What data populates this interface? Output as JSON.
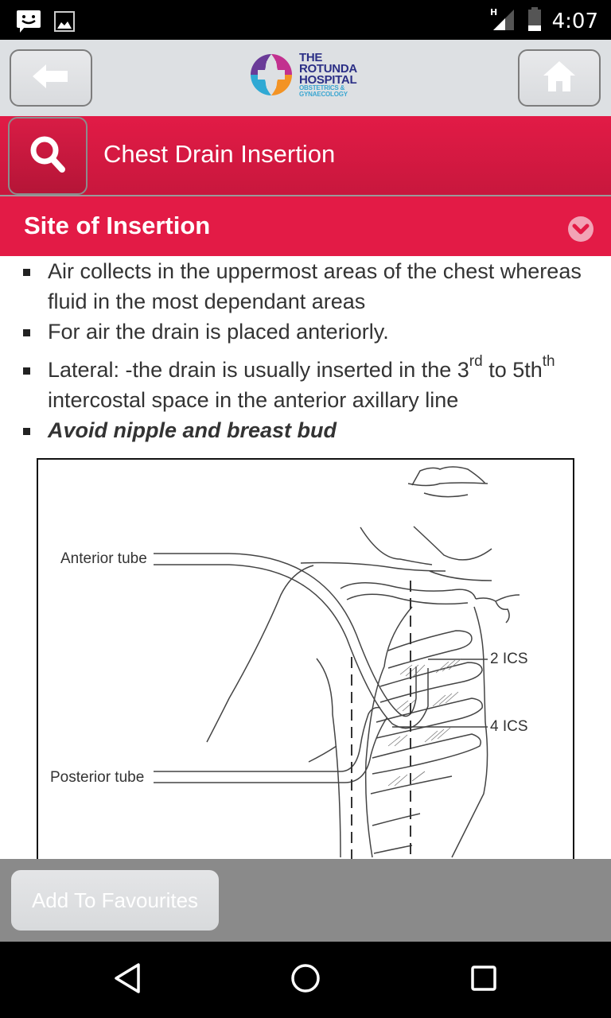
{
  "status_bar": {
    "left_icons": [
      "messenger-icon",
      "image-icon"
    ],
    "network_type": "H",
    "battery_level_fraction": 0.25,
    "time": "4:07"
  },
  "header": {
    "back_icon": "arrow-left-icon",
    "home_icon": "home-icon",
    "logo": {
      "line1": "THE",
      "line2": "ROTUNDA",
      "line3": "HOSPITAL",
      "line4": "OBSTETRICS &",
      "line5": "GYNAECOLOGY"
    }
  },
  "title_bar": {
    "search_icon": "search-icon",
    "title": "Chest Drain Insertion"
  },
  "section": {
    "title": "Site of Insertion",
    "state": "expanded",
    "toggle_icon": "chevron-down-circle-icon"
  },
  "content": {
    "bullets": [
      {
        "text": "Air collects in the uppermost areas of the chest whereas fluid in the most dependant areas"
      },
      {
        "text": "For air the drain is placed anteriorly."
      },
      {
        "part1": "Lateral: -the drain is usually inserted in the 3",
        "sup1": "rd",
        "part2": " to 5th",
        "sup2": "th",
        "part3": " intercostal space in the anterior axillary line"
      },
      {
        "text": "Avoid nipple and breast bud"
      }
    ],
    "diagram": {
      "labels": {
        "anterior_tube": "Anterior tube",
        "posterior_tube": "Posterior tube",
        "ics2": "2 ICS",
        "ics4": "4 ICS"
      }
    }
  },
  "footer": {
    "favourites_label": "Add To Favourites"
  },
  "colors": {
    "brand_red": "#e31b46",
    "header_grey": "#dde0e3",
    "footer_grey": "#8a8a8a"
  },
  "navbar": {
    "buttons": [
      "back-nav-icon",
      "home-nav-icon",
      "recents-nav-icon"
    ]
  }
}
